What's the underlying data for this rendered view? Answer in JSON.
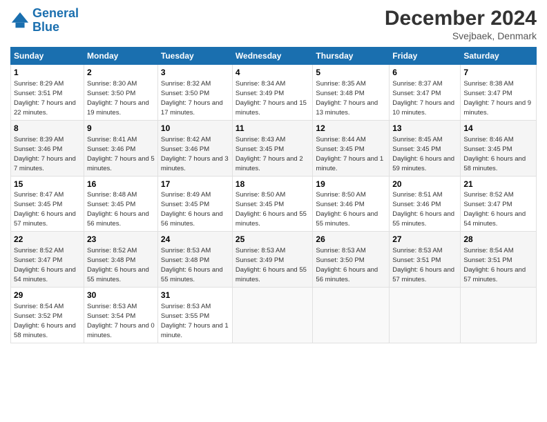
{
  "logo": {
    "line1": "General",
    "line2": "Blue"
  },
  "title": "December 2024",
  "subtitle": "Svejbaek, Denmark",
  "headers": [
    "Sunday",
    "Monday",
    "Tuesday",
    "Wednesday",
    "Thursday",
    "Friday",
    "Saturday"
  ],
  "weeks": [
    [
      {
        "day": "1",
        "sunrise": "8:29 AM",
        "sunset": "3:51 PM",
        "daylight": "7 hours and 22 minutes."
      },
      {
        "day": "2",
        "sunrise": "8:30 AM",
        "sunset": "3:50 PM",
        "daylight": "7 hours and 19 minutes."
      },
      {
        "day": "3",
        "sunrise": "8:32 AM",
        "sunset": "3:50 PM",
        "daylight": "7 hours and 17 minutes."
      },
      {
        "day": "4",
        "sunrise": "8:34 AM",
        "sunset": "3:49 PM",
        "daylight": "7 hours and 15 minutes."
      },
      {
        "day": "5",
        "sunrise": "8:35 AM",
        "sunset": "3:48 PM",
        "daylight": "7 hours and 13 minutes."
      },
      {
        "day": "6",
        "sunrise": "8:37 AM",
        "sunset": "3:47 PM",
        "daylight": "7 hours and 10 minutes."
      },
      {
        "day": "7",
        "sunrise": "8:38 AM",
        "sunset": "3:47 PM",
        "daylight": "7 hours and 9 minutes."
      }
    ],
    [
      {
        "day": "8",
        "sunrise": "8:39 AM",
        "sunset": "3:46 PM",
        "daylight": "7 hours and 7 minutes."
      },
      {
        "day": "9",
        "sunrise": "8:41 AM",
        "sunset": "3:46 PM",
        "daylight": "7 hours and 5 minutes."
      },
      {
        "day": "10",
        "sunrise": "8:42 AM",
        "sunset": "3:46 PM",
        "daylight": "7 hours and 3 minutes."
      },
      {
        "day": "11",
        "sunrise": "8:43 AM",
        "sunset": "3:45 PM",
        "daylight": "7 hours and 2 minutes."
      },
      {
        "day": "12",
        "sunrise": "8:44 AM",
        "sunset": "3:45 PM",
        "daylight": "7 hours and 1 minute."
      },
      {
        "day": "13",
        "sunrise": "8:45 AM",
        "sunset": "3:45 PM",
        "daylight": "6 hours and 59 minutes."
      },
      {
        "day": "14",
        "sunrise": "8:46 AM",
        "sunset": "3:45 PM",
        "daylight": "6 hours and 58 minutes."
      }
    ],
    [
      {
        "day": "15",
        "sunrise": "8:47 AM",
        "sunset": "3:45 PM",
        "daylight": "6 hours and 57 minutes."
      },
      {
        "day": "16",
        "sunrise": "8:48 AM",
        "sunset": "3:45 PM",
        "daylight": "6 hours and 56 minutes."
      },
      {
        "day": "17",
        "sunrise": "8:49 AM",
        "sunset": "3:45 PM",
        "daylight": "6 hours and 56 minutes."
      },
      {
        "day": "18",
        "sunrise": "8:50 AM",
        "sunset": "3:45 PM",
        "daylight": "6 hours and 55 minutes."
      },
      {
        "day": "19",
        "sunrise": "8:50 AM",
        "sunset": "3:46 PM",
        "daylight": "6 hours and 55 minutes."
      },
      {
        "day": "20",
        "sunrise": "8:51 AM",
        "sunset": "3:46 PM",
        "daylight": "6 hours and 55 minutes."
      },
      {
        "day": "21",
        "sunrise": "8:52 AM",
        "sunset": "3:47 PM",
        "daylight": "6 hours and 54 minutes."
      }
    ],
    [
      {
        "day": "22",
        "sunrise": "8:52 AM",
        "sunset": "3:47 PM",
        "daylight": "6 hours and 54 minutes."
      },
      {
        "day": "23",
        "sunrise": "8:52 AM",
        "sunset": "3:48 PM",
        "daylight": "6 hours and 55 minutes."
      },
      {
        "day": "24",
        "sunrise": "8:53 AM",
        "sunset": "3:48 PM",
        "daylight": "6 hours and 55 minutes."
      },
      {
        "day": "25",
        "sunrise": "8:53 AM",
        "sunset": "3:49 PM",
        "daylight": "6 hours and 55 minutes."
      },
      {
        "day": "26",
        "sunrise": "8:53 AM",
        "sunset": "3:50 PM",
        "daylight": "6 hours and 56 minutes."
      },
      {
        "day": "27",
        "sunrise": "8:53 AM",
        "sunset": "3:51 PM",
        "daylight": "6 hours and 57 minutes."
      },
      {
        "day": "28",
        "sunrise": "8:54 AM",
        "sunset": "3:51 PM",
        "daylight": "6 hours and 57 minutes."
      }
    ],
    [
      {
        "day": "29",
        "sunrise": "8:54 AM",
        "sunset": "3:52 PM",
        "daylight": "6 hours and 58 minutes."
      },
      {
        "day": "30",
        "sunrise": "8:53 AM",
        "sunset": "3:54 PM",
        "daylight": "7 hours and 0 minutes."
      },
      {
        "day": "31",
        "sunrise": "8:53 AM",
        "sunset": "3:55 PM",
        "daylight": "7 hours and 1 minute."
      },
      null,
      null,
      null,
      null
    ]
  ]
}
